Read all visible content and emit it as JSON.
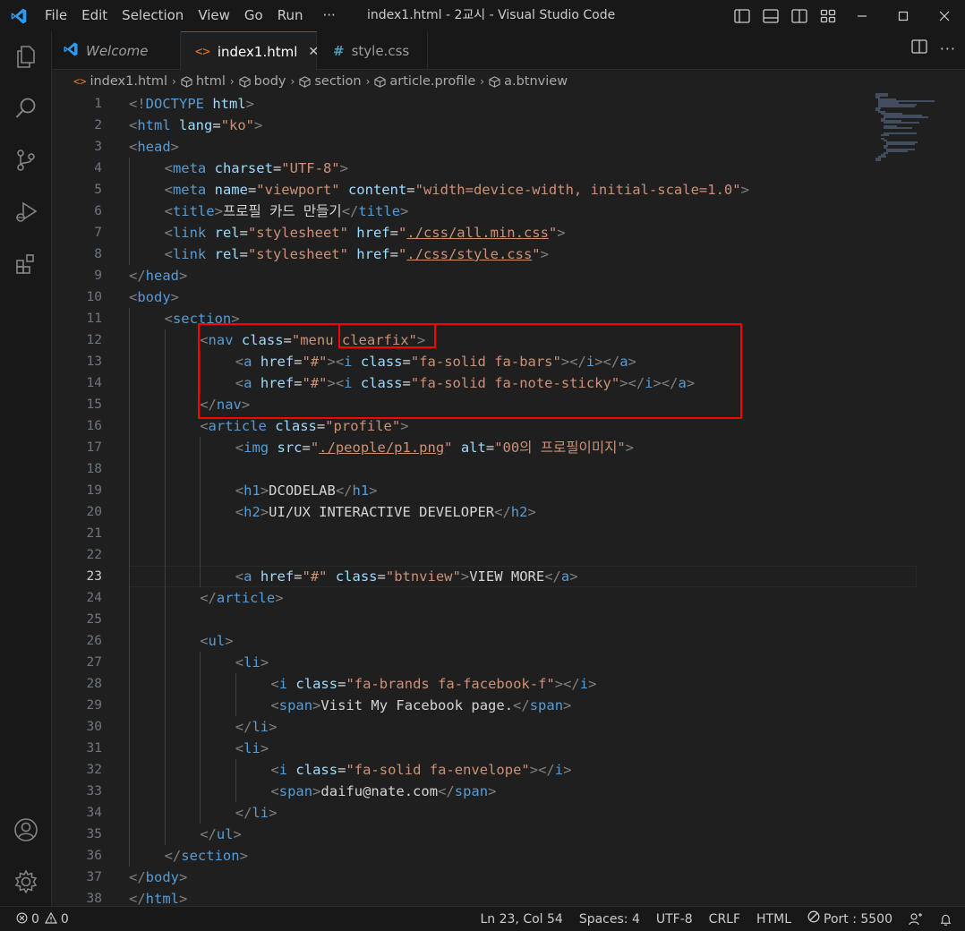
{
  "window": {
    "title": "index1.html - 2교시 - Visual Studio Code",
    "menu": [
      "File",
      "Edit",
      "Selection",
      "View",
      "Go",
      "Run",
      "···"
    ],
    "accent": "#0078d4"
  },
  "tabs": [
    {
      "label": "Welcome",
      "icon": "vscode-icon",
      "active": false
    },
    {
      "label": "index1.html",
      "icon": "html-icon",
      "active": true
    },
    {
      "label": "style.css",
      "icon": "css-hash-icon",
      "active": false
    }
  ],
  "breadcrumb": [
    "index1.html",
    "html",
    "body",
    "section",
    "article.profile",
    "a.btnview"
  ],
  "editor": {
    "current_line": 23,
    "highlight_color": "#ff0000",
    "lines": [
      {
        "n": "1",
        "i": 0,
        "t": [
          [
            "p",
            "<!"
          ],
          [
            "tag",
            "DOCTYPE"
          ],
          [
            "tx",
            " "
          ],
          [
            "attr",
            "html"
          ],
          [
            "p",
            ">"
          ]
        ]
      },
      {
        "n": "2",
        "i": 0,
        "t": [
          [
            "p",
            "<"
          ],
          [
            "tag",
            "html"
          ],
          [
            "tx",
            " "
          ],
          [
            "attr",
            "lang"
          ],
          [
            "tx",
            "="
          ],
          [
            "str",
            "\"ko\""
          ],
          [
            "p",
            ">"
          ]
        ]
      },
      {
        "n": "3",
        "i": 0,
        "t": [
          [
            "p",
            "<"
          ],
          [
            "tag",
            "head"
          ],
          [
            "p",
            ">"
          ]
        ]
      },
      {
        "n": "4",
        "i": 1,
        "t": [
          [
            "p",
            "<"
          ],
          [
            "tag",
            "meta"
          ],
          [
            "tx",
            " "
          ],
          [
            "attr",
            "charset"
          ],
          [
            "tx",
            "="
          ],
          [
            "str",
            "\"UTF-8\""
          ],
          [
            "p",
            ">"
          ]
        ]
      },
      {
        "n": "5",
        "i": 1,
        "t": [
          [
            "p",
            "<"
          ],
          [
            "tag",
            "meta"
          ],
          [
            "tx",
            " "
          ],
          [
            "attr",
            "name"
          ],
          [
            "tx",
            "="
          ],
          [
            "str",
            "\"viewport\""
          ],
          [
            "tx",
            " "
          ],
          [
            "attr",
            "content"
          ],
          [
            "tx",
            "="
          ],
          [
            "str",
            "\"width=device-width, initial-scale=1.0\""
          ],
          [
            "p",
            ">"
          ]
        ]
      },
      {
        "n": "6",
        "i": 1,
        "t": [
          [
            "p",
            "<"
          ],
          [
            "tag",
            "title"
          ],
          [
            "p",
            ">"
          ],
          [
            "tx",
            "프로필 카드 만들기"
          ],
          [
            "p",
            "</"
          ],
          [
            "tag",
            "title"
          ],
          [
            "p",
            ">"
          ]
        ]
      },
      {
        "n": "7",
        "i": 1,
        "t": [
          [
            "p",
            "<"
          ],
          [
            "tag",
            "link"
          ],
          [
            "tx",
            " "
          ],
          [
            "attr",
            "rel"
          ],
          [
            "tx",
            "="
          ],
          [
            "str",
            "\"stylesheet\""
          ],
          [
            "tx",
            " "
          ],
          [
            "attr",
            "href"
          ],
          [
            "tx",
            "="
          ],
          [
            "str",
            "\""
          ],
          [
            "stru",
            "./css/all.min.css"
          ],
          [
            "str",
            "\""
          ],
          [
            "p",
            ">"
          ]
        ]
      },
      {
        "n": "8",
        "i": 1,
        "t": [
          [
            "p",
            "<"
          ],
          [
            "tag",
            "link"
          ],
          [
            "tx",
            " "
          ],
          [
            "attr",
            "rel"
          ],
          [
            "tx",
            "="
          ],
          [
            "str",
            "\"stylesheet\""
          ],
          [
            "tx",
            " "
          ],
          [
            "attr",
            "href"
          ],
          [
            "tx",
            "="
          ],
          [
            "str",
            "\""
          ],
          [
            "stru",
            "./css/style.css"
          ],
          [
            "str",
            "\""
          ],
          [
            "p",
            ">"
          ]
        ]
      },
      {
        "n": "9",
        "i": 0,
        "t": [
          [
            "p",
            "</"
          ],
          [
            "tag",
            "head"
          ],
          [
            "p",
            ">"
          ]
        ]
      },
      {
        "n": "10",
        "i": 0,
        "t": [
          [
            "p",
            "<"
          ],
          [
            "tag",
            "body"
          ],
          [
            "p",
            ">"
          ]
        ]
      },
      {
        "n": "11",
        "i": 1,
        "t": [
          [
            "p",
            "<"
          ],
          [
            "tag",
            "section"
          ],
          [
            "p",
            ">"
          ]
        ]
      },
      {
        "n": "12",
        "i": 2,
        "t": [
          [
            "p",
            "<"
          ],
          [
            "tag",
            "nav"
          ],
          [
            "tx",
            " "
          ],
          [
            "attr",
            "class"
          ],
          [
            "tx",
            "="
          ],
          [
            "str",
            "\"menu clearfix\""
          ],
          [
            "p",
            ">"
          ]
        ]
      },
      {
        "n": "13",
        "i": 3,
        "t": [
          [
            "p",
            "<"
          ],
          [
            "tag",
            "a"
          ],
          [
            "tx",
            " "
          ],
          [
            "attr",
            "href"
          ],
          [
            "tx",
            "="
          ],
          [
            "str",
            "\"#\""
          ],
          [
            "p",
            "><"
          ],
          [
            "tag",
            "i"
          ],
          [
            "tx",
            " "
          ],
          [
            "attr",
            "class"
          ],
          [
            "tx",
            "="
          ],
          [
            "str",
            "\"fa-solid fa-bars\""
          ],
          [
            "p",
            "></"
          ],
          [
            "tag",
            "i"
          ],
          [
            "p",
            "></"
          ],
          [
            "tag",
            "a"
          ],
          [
            "p",
            ">"
          ]
        ]
      },
      {
        "n": "14",
        "i": 3,
        "t": [
          [
            "p",
            "<"
          ],
          [
            "tag",
            "a"
          ],
          [
            "tx",
            " "
          ],
          [
            "attr",
            "href"
          ],
          [
            "tx",
            "="
          ],
          [
            "str",
            "\"#\""
          ],
          [
            "p",
            "><"
          ],
          [
            "tag",
            "i"
          ],
          [
            "tx",
            " "
          ],
          [
            "attr",
            "class"
          ],
          [
            "tx",
            "="
          ],
          [
            "str",
            "\"fa-solid fa-note-sticky\""
          ],
          [
            "p",
            "></"
          ],
          [
            "tag",
            "i"
          ],
          [
            "p",
            "></"
          ],
          [
            "tag",
            "a"
          ],
          [
            "p",
            ">"
          ]
        ]
      },
      {
        "n": "15",
        "i": 2,
        "t": [
          [
            "p",
            "</"
          ],
          [
            "tag",
            "nav"
          ],
          [
            "p",
            ">"
          ]
        ]
      },
      {
        "n": "16",
        "i": 2,
        "t": [
          [
            "p",
            "<"
          ],
          [
            "tag",
            "article"
          ],
          [
            "tx",
            " "
          ],
          [
            "attr",
            "class"
          ],
          [
            "tx",
            "="
          ],
          [
            "str",
            "\"profile\""
          ],
          [
            "p",
            ">"
          ]
        ]
      },
      {
        "n": "17",
        "i": 3,
        "t": [
          [
            "p",
            "<"
          ],
          [
            "tag",
            "img"
          ],
          [
            "tx",
            " "
          ],
          [
            "attr",
            "src"
          ],
          [
            "tx",
            "="
          ],
          [
            "str",
            "\""
          ],
          [
            "stru",
            "./people/p1.png"
          ],
          [
            "str",
            "\""
          ],
          [
            "tx",
            " "
          ],
          [
            "attr",
            "alt"
          ],
          [
            "tx",
            "="
          ],
          [
            "str",
            "\"00의 프로필이미지\""
          ],
          [
            "p",
            ">"
          ]
        ]
      },
      {
        "n": "18",
        "i": 3,
        "t": []
      },
      {
        "n": "19",
        "i": 3,
        "t": [
          [
            "p",
            "<"
          ],
          [
            "tag",
            "h1"
          ],
          [
            "p",
            ">"
          ],
          [
            "tx",
            "DCODELAB"
          ],
          [
            "p",
            "</"
          ],
          [
            "tag",
            "h1"
          ],
          [
            "p",
            ">"
          ]
        ]
      },
      {
        "n": "20",
        "i": 3,
        "t": [
          [
            "p",
            "<"
          ],
          [
            "tag",
            "h2"
          ],
          [
            "p",
            ">"
          ],
          [
            "tx",
            "UI/UX INTERACTIVE DEVELOPER"
          ],
          [
            "p",
            "</"
          ],
          [
            "tag",
            "h2"
          ],
          [
            "p",
            ">"
          ]
        ]
      },
      {
        "n": "21",
        "i": 3,
        "t": []
      },
      {
        "n": "22",
        "i": 3,
        "t": []
      },
      {
        "n": "23",
        "i": 3,
        "t": [
          [
            "p",
            "<"
          ],
          [
            "tag",
            "a"
          ],
          [
            "tx",
            " "
          ],
          [
            "attr",
            "href"
          ],
          [
            "tx",
            "="
          ],
          [
            "str",
            "\"#\""
          ],
          [
            "tx",
            " "
          ],
          [
            "attr",
            "class"
          ],
          [
            "tx",
            "="
          ],
          [
            "str",
            "\"btnview\""
          ],
          [
            "p",
            ">"
          ],
          [
            "tx",
            "VIEW MORE"
          ],
          [
            "p",
            "</"
          ],
          [
            "tag",
            "a"
          ],
          [
            "p",
            ">"
          ]
        ]
      },
      {
        "n": "24",
        "i": 2,
        "t": [
          [
            "p",
            "</"
          ],
          [
            "tag",
            "article"
          ],
          [
            "p",
            ">"
          ]
        ]
      },
      {
        "n": "25",
        "i": 2,
        "t": []
      },
      {
        "n": "26",
        "i": 2,
        "t": [
          [
            "p",
            "<"
          ],
          [
            "tag",
            "ul"
          ],
          [
            "p",
            ">"
          ]
        ]
      },
      {
        "n": "27",
        "i": 3,
        "t": [
          [
            "p",
            "<"
          ],
          [
            "tag",
            "li"
          ],
          [
            "p",
            ">"
          ]
        ]
      },
      {
        "n": "28",
        "i": 4,
        "t": [
          [
            "p",
            "<"
          ],
          [
            "tag",
            "i"
          ],
          [
            "tx",
            " "
          ],
          [
            "attr",
            "class"
          ],
          [
            "tx",
            "="
          ],
          [
            "str",
            "\"fa-brands fa-facebook-f\""
          ],
          [
            "p",
            "></"
          ],
          [
            "tag",
            "i"
          ],
          [
            "p",
            ">"
          ]
        ]
      },
      {
        "n": "29",
        "i": 4,
        "t": [
          [
            "p",
            "<"
          ],
          [
            "tag",
            "span"
          ],
          [
            "p",
            ">"
          ],
          [
            "tx",
            "Visit My Facebook page."
          ],
          [
            "p",
            "</"
          ],
          [
            "tag",
            "span"
          ],
          [
            "p",
            ">"
          ]
        ]
      },
      {
        "n": "30",
        "i": 3,
        "t": [
          [
            "p",
            "</"
          ],
          [
            "tag",
            "li"
          ],
          [
            "p",
            ">"
          ]
        ]
      },
      {
        "n": "31",
        "i": 3,
        "t": [
          [
            "p",
            "<"
          ],
          [
            "tag",
            "li"
          ],
          [
            "p",
            ">"
          ]
        ]
      },
      {
        "n": "32",
        "i": 4,
        "t": [
          [
            "p",
            "<"
          ],
          [
            "tag",
            "i"
          ],
          [
            "tx",
            " "
          ],
          [
            "attr",
            "class"
          ],
          [
            "tx",
            "="
          ],
          [
            "str",
            "\"fa-solid fa-envelope\""
          ],
          [
            "p",
            "></"
          ],
          [
            "tag",
            "i"
          ],
          [
            "p",
            ">"
          ]
        ]
      },
      {
        "n": "33",
        "i": 4,
        "t": [
          [
            "p",
            "<"
          ],
          [
            "tag",
            "span"
          ],
          [
            "p",
            ">"
          ],
          [
            "tx",
            "daifu@nate.com"
          ],
          [
            "p",
            "</"
          ],
          [
            "tag",
            "span"
          ],
          [
            "p",
            ">"
          ]
        ]
      },
      {
        "n": "34",
        "i": 3,
        "t": [
          [
            "p",
            "</"
          ],
          [
            "tag",
            "li"
          ],
          [
            "p",
            ">"
          ]
        ]
      },
      {
        "n": "35",
        "i": 2,
        "t": [
          [
            "p",
            "</"
          ],
          [
            "tag",
            "ul"
          ],
          [
            "p",
            ">"
          ]
        ]
      },
      {
        "n": "36",
        "i": 1,
        "t": [
          [
            "p",
            "</"
          ],
          [
            "tag",
            "section"
          ],
          [
            "p",
            ">"
          ]
        ]
      },
      {
        "n": "37",
        "i": 0,
        "t": [
          [
            "p",
            "</"
          ],
          [
            "tag",
            "body"
          ],
          [
            "p",
            ">"
          ]
        ]
      },
      {
        "n": "38",
        "i": 0,
        "t": [
          [
            "p",
            "</"
          ],
          [
            "tag",
            "html"
          ],
          [
            "p",
            ">"
          ]
        ]
      }
    ]
  },
  "statusbar": {
    "errors": "0",
    "warnings": "0",
    "position": "Ln 23, Col 54",
    "spaces": "Spaces: 4",
    "encoding": "UTF-8",
    "eol": "CRLF",
    "language": "HTML",
    "port": "Port : 5500"
  }
}
